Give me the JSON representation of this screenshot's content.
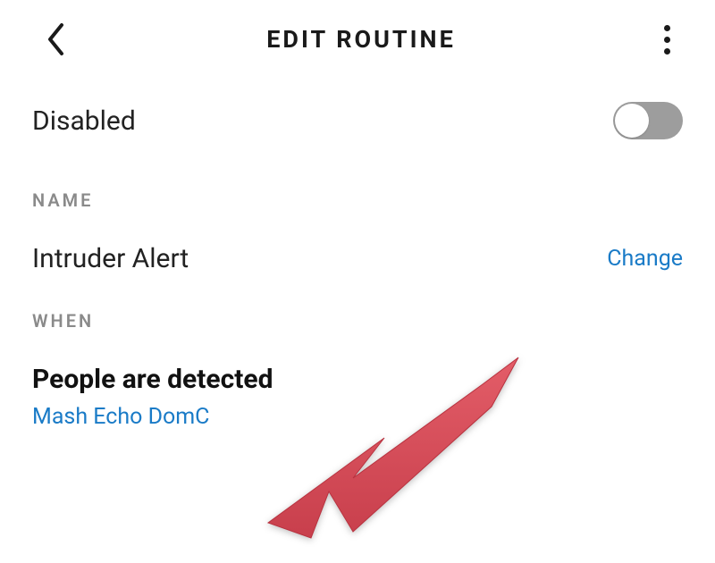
{
  "header": {
    "title": "EDIT ROUTINE"
  },
  "status": {
    "label": "Disabled"
  },
  "sections": {
    "name_label": "NAME",
    "when_label": "WHEN"
  },
  "name": {
    "value": "Intruder Alert",
    "change_label": "Change"
  },
  "when": {
    "trigger": "People are detected",
    "device": "Mash Echo DomC"
  },
  "colors": {
    "link": "#1a7bc7",
    "arrow": "#da4f5b"
  }
}
